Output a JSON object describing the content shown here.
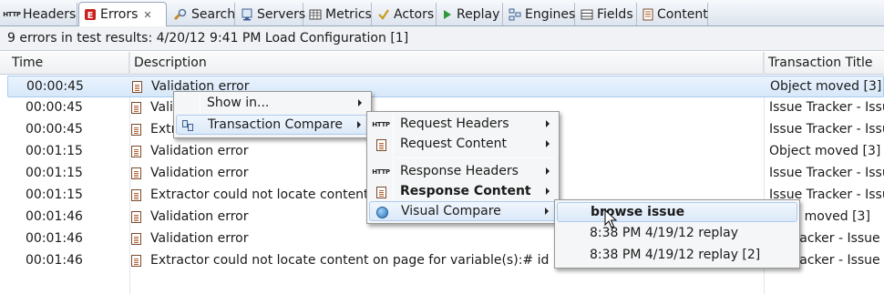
{
  "tabs": [
    {
      "label": "Headers",
      "icon": "http-icon",
      "active": false
    },
    {
      "label": "Errors",
      "icon": "errors-icon",
      "active": true,
      "closable": true
    },
    {
      "label": "Search",
      "icon": "search-icon",
      "active": false
    },
    {
      "label": "Servers",
      "icon": "servers-icon",
      "active": false
    },
    {
      "label": "Metrics",
      "icon": "metrics-icon",
      "active": false
    },
    {
      "label": "Actors",
      "icon": "actors-icon",
      "active": false
    },
    {
      "label": "Replay",
      "icon": "replay-icon",
      "active": false
    },
    {
      "label": "Engines",
      "icon": "engines-icon",
      "active": false
    },
    {
      "label": "Fields",
      "icon": "fields-icon",
      "active": false
    },
    {
      "label": "Content",
      "icon": "content-icon",
      "active": false
    }
  ],
  "info_bar": "9 errors in test results: 4/20/12 9:41 PM Load Configuration [1]",
  "table": {
    "columns": [
      "Time",
      "Description",
      "Transaction Title"
    ],
    "rows": [
      {
        "time": "00:00:45",
        "description": "Validation error",
        "title": "Object moved [3]"
      },
      {
        "time": "00:00:45",
        "description": "Vali",
        "title": "Issue Tracker - Issue"
      },
      {
        "time": "00:00:45",
        "description": "Extr",
        "title": "Issue Tracker - Issue"
      },
      {
        "time": "00:01:15",
        "description": "Validation error",
        "title": "Object moved [3]"
      },
      {
        "time": "00:01:15",
        "description": "Validation error",
        "title": "Issue Tracker - Issue"
      },
      {
        "time": "00:01:15",
        "description": "Extractor could not locate content o",
        "title": "Issue Tracker - Issue"
      },
      {
        "time": "00:01:46",
        "description": "Validation error",
        "title": "ct moved [3]"
      },
      {
        "time": "00:01:46",
        "description": "Validation error",
        "title": "Tracker - Issue"
      },
      {
        "time": "00:01:46",
        "description": "Extractor could not locate content on page for variable(s):# id [1]",
        "title": "Tracker - Issue"
      }
    ]
  },
  "context_menu": {
    "items": [
      "Show in...",
      "Transaction Compare"
    ]
  },
  "compare_menu": {
    "items": [
      {
        "label": "Request Headers",
        "icon": "http-icon"
      },
      {
        "label": "Request Content",
        "icon": "document-icon"
      },
      {
        "label": "Response Headers",
        "icon": "http-icon"
      },
      {
        "label": "Response Content",
        "icon": "document-icon",
        "bold": true
      },
      {
        "label": "Visual Compare",
        "icon": "globe-icon"
      }
    ]
  },
  "visual_menu": {
    "items": [
      "browse issue",
      "8:38 PM 4/19/12 replay",
      "8:38 PM 4/19/12 replay [2]"
    ]
  },
  "colors": {
    "selection": "#d7e8fa",
    "menu_bg": "#f5f6f7",
    "error_icon": "#c8201e"
  }
}
